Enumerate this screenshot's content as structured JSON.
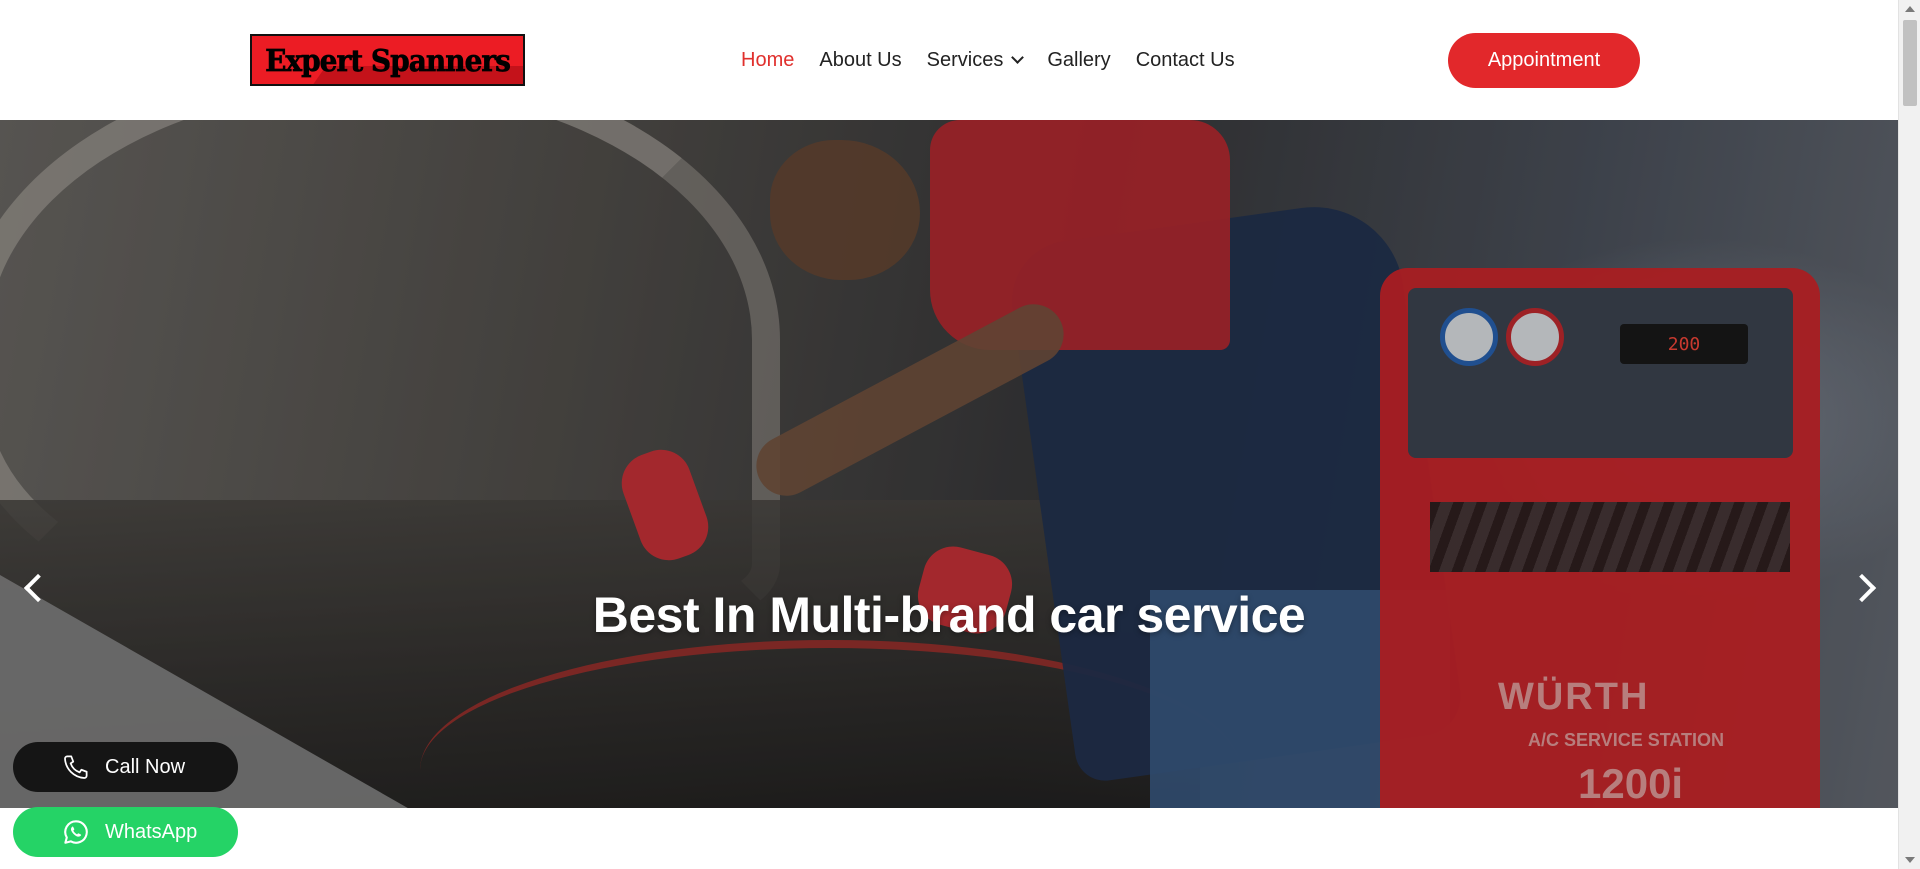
{
  "header": {
    "logo_text": "Expert Spanners",
    "nav": [
      {
        "label": "Home",
        "active": true
      },
      {
        "label": "About Us",
        "active": false
      },
      {
        "label": "Services",
        "active": false,
        "has_dropdown": true
      },
      {
        "label": "Gallery",
        "active": false
      },
      {
        "label": "Contact Us",
        "active": false
      }
    ],
    "appointment_label": "Appointment"
  },
  "hero": {
    "title": "Best In Multi-brand car service",
    "machine_display": "200",
    "brand_mark": "WÜRTH",
    "brand_sub": "A/C SERVICE STATION",
    "brand_model": "1200i",
    "prev_icon": "chevron-left-icon",
    "next_icon": "chevron-right-icon"
  },
  "floating": {
    "call_label": "Call Now",
    "call_icon": "phone-icon",
    "whatsapp_label": "WhatsApp",
    "whatsapp_icon": "whatsapp-icon"
  },
  "colors": {
    "accent": "#e2282b",
    "nav_active": "#e0302d",
    "whatsapp": "#25d366",
    "call_button": "#151515",
    "logo_bg": "#ec1c24"
  }
}
